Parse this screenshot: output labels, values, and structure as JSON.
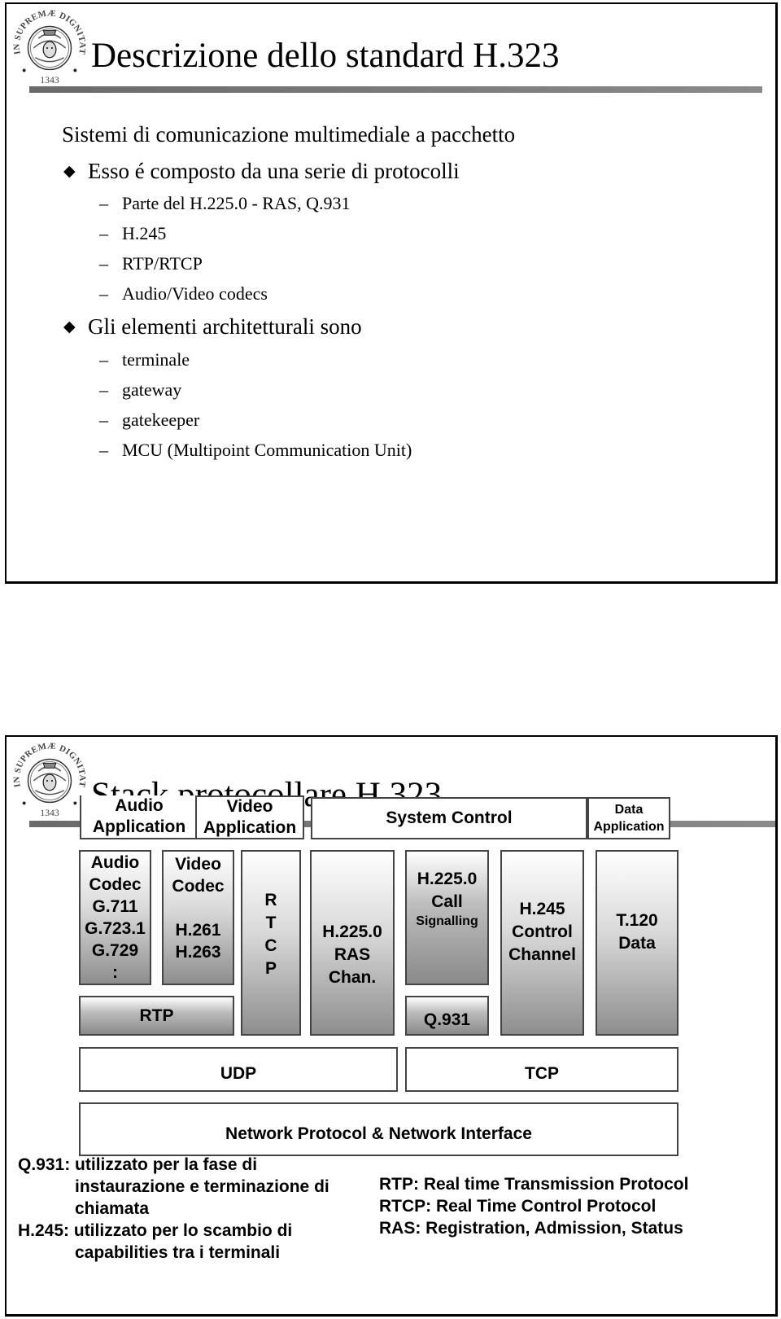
{
  "slides": [
    {
      "title": "Descrizione dello standard H.323",
      "logo": "university-seal-icon",
      "intro": "Sistemi di comunicazione multimediale a pacchetto",
      "bullets": [
        {
          "text": "Esso é composto da una serie di protocolli",
          "items": [
            "Parte del H.225.0 - RAS, Q.931",
            "H.245",
            "RTP/RTCP",
            "Audio/Video codecs"
          ]
        },
        {
          "text": "Gli elementi architetturali sono",
          "items": [
            "terminale",
            "gateway",
            "gatekeeper",
            "MCU (Multipoint Communication Unit)"
          ]
        }
      ],
      "bullet_icon": "◆",
      "dash": "–"
    },
    {
      "title": "Stack protocollare H.323",
      "logo": "university-seal-icon",
      "seal_text": {
        "top": "IN SUPREMÆ DIGNITATIS",
        "year": "1343"
      },
      "stack": {
        "audio_app": [
          "Audio",
          "Application"
        ],
        "video_app": [
          "Video",
          "Application"
        ],
        "system_control": "System Control",
        "data_app": [
          "Data",
          "Application"
        ],
        "audio_codec": [
          "Audio",
          "Codec",
          "G.711",
          "G.723.1",
          "G.729",
          ":"
        ],
        "video_codec": [
          "Video",
          "Codec",
          "",
          "H.261",
          "H.263"
        ],
        "rtcp": [
          "R",
          "T",
          "C",
          "P"
        ],
        "ras": [
          "H.225.0",
          "RAS",
          "Chan."
        ],
        "call_signalling": [
          "H.225.0",
          "Call",
          "Signalling"
        ],
        "h245": [
          "H.245",
          "Control",
          "Channel"
        ],
        "t120": [
          "T.120",
          "Data"
        ],
        "rtp": "RTP",
        "q931": "Q.931",
        "udp": "UDP",
        "tcp": "TCP",
        "network": "Network Protocol & Network Interface"
      },
      "notes_left": [
        {
          "text": "Q.931: utilizzato per la fase di",
          "indent": false
        },
        {
          "text": "instaurazione e terminazione di",
          "indent": true
        },
        {
          "text": "chiamata",
          "indent": true
        },
        {
          "text": "H.245: utilizzato per lo scambio di",
          "indent": false
        },
        {
          "text": "capabilities tra i terminali",
          "indent": true
        }
      ],
      "notes_right": [
        "RTP: Real time Transmission Protocol",
        "RTCP: Real Time Control Protocol",
        "RAS: Registration, Admission, Status"
      ]
    }
  ]
}
